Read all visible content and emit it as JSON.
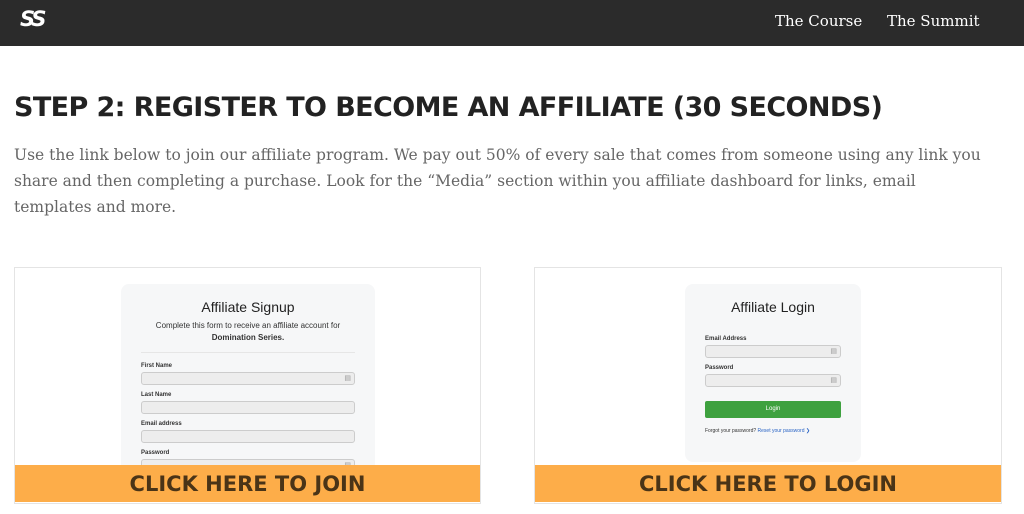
{
  "header": {
    "logo": "SS",
    "nav": [
      "The Course",
      "The Summit"
    ]
  },
  "main": {
    "title": "STEP 2: REGISTER TO BECOME AN AFFILIATE (30 SECONDS)",
    "description": "Use the link below to join our affiliate program. We pay out 50% of every sale that comes from someone using any link you share and then completing a purchase. Look for the “Media” section within you affiliate dashboard for links, email templates and more."
  },
  "join_card": {
    "form_title": "Affiliate Signup",
    "form_subtitle": "Complete this form to receive an affiliate account for",
    "form_subtitle_bold": "Domination Series.",
    "fields": [
      "First Name",
      "Last Name",
      "Email address",
      "Password"
    ],
    "cta": "CLICK HERE TO JOIN"
  },
  "login_card": {
    "form_title": "Affiliate Login",
    "fields": [
      "Email Address",
      "Password"
    ],
    "button": "Login",
    "forgot_text": "Forgot your password?",
    "reset_link": "Reset your password ❯",
    "cta": "CLICK HERE TO LOGIN"
  },
  "colors": {
    "topbar": "#2b2b2b",
    "cta_background": "#fdad49",
    "cta_text": "#4a3417",
    "login_button": "#3ea13f"
  },
  "icons": {
    "field_icon": "lock-icon"
  }
}
